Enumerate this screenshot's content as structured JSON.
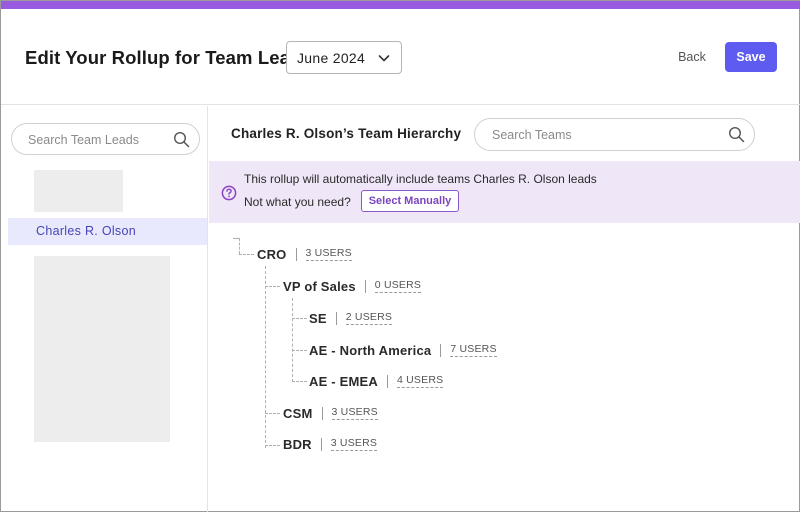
{
  "header": {
    "title": "Edit Your Rollup for Team Lead",
    "month": "June 2024",
    "back_label": "Back",
    "save_label": "Save"
  },
  "sidebar": {
    "search_placeholder": "Search Team Leads",
    "active_lead": "Charles R. Olson"
  },
  "main": {
    "hierarchy_title": "Charles R. Olson’s Team Hierarchy",
    "search_placeholder": "Search Teams",
    "banner": {
      "line1": "This rollup will automatically include teams Charles R. Olson leads",
      "line2": "Not what you need?",
      "select_label": "Select Manually"
    },
    "tree": [
      {
        "name": "CRO",
        "users": "3 USERS"
      },
      {
        "name": "VP of Sales",
        "users": "0 USERS"
      },
      {
        "name": "SE",
        "users": "2 USERS"
      },
      {
        "name": "AE - North America",
        "users": "7 USERS"
      },
      {
        "name": "AE - EMEA",
        "users": "4 USERS"
      },
      {
        "name": "CSM",
        "users": "3 USERS"
      },
      {
        "name": "BDR",
        "users": "3 USERS"
      }
    ]
  },
  "colors": {
    "accent": "#9a5ae0",
    "primary_button": "#5e5cf0",
    "active_item_bg": "#e9e9fd",
    "active_item_text": "#4744b8",
    "banner_bg": "#efe7f7"
  },
  "icons": {
    "month_dropdown": "chevron-down-icon",
    "search": "search-icon",
    "banner": "question-circle-icon"
  }
}
